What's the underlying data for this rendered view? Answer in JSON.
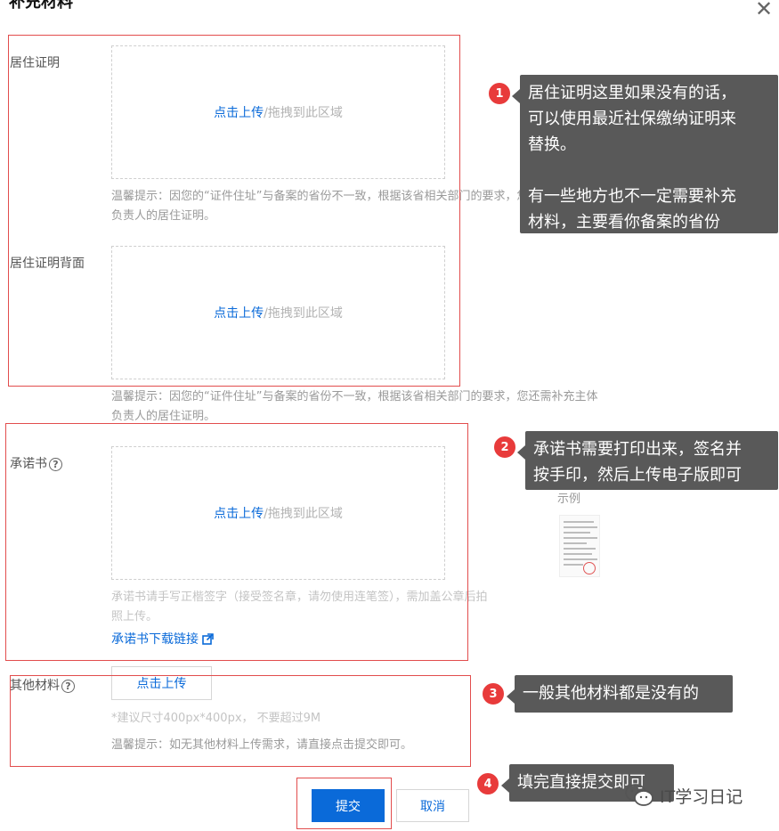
{
  "dialog": {
    "title": "补充材料",
    "close_glyph": "✕"
  },
  "fields": {
    "residence": {
      "label": "居住证明"
    },
    "residence_back": {
      "label": "居住证明背面"
    },
    "commitment": {
      "label": "承诺书"
    },
    "other": {
      "label": "其他材料"
    }
  },
  "dropzone": {
    "link_text": "点击上传",
    "rest_text": "/拖拽到此区域"
  },
  "hints": {
    "residence": [
      "温馨提示：因您的“证件住址”与备案的省份不一致，根据该省相关部门的要求，您还需补充主体",
      "负责人的居住证明。"
    ],
    "residence_back": [
      "温馨提示：因您的“证件住址”与备案的省份不一致，根据该省相关部门的要求，您还需补充主体",
      "负责人的居住证明。"
    ],
    "commitment": [
      "承诺书请手写正楷签字（接受签名章，请勿使用连笔签），需加盖公章后拍",
      "照上传。"
    ],
    "other_size": "*建议尺寸400px*400px， 不要超过9M",
    "other": "温馨提示：如无其他材料上传需求，请直接点击提交即可。"
  },
  "commitment_download_link": "承诺书下载链接",
  "sample_label": "示例",
  "buttons": {
    "upload": "点击上传",
    "submit": "提交",
    "cancel": "取消"
  },
  "callouts": [
    {
      "num": "1",
      "lines": [
        "居住证明这里如果没有的话，",
        "可以使用最近社保缴纳证明来",
        "替换。",
        "",
        "有一些地方也不一定需要补充",
        "材料，主要看你备案的省份"
      ]
    },
    {
      "num": "2",
      "lines": [
        "承诺书需要打印出来，签名并",
        "按手印，然后上传电子版即可"
      ]
    },
    {
      "num": "3",
      "lines": [
        "一般其他材料都是没有的"
      ]
    },
    {
      "num": "4",
      "lines": [
        "填完直接提交即可"
      ]
    }
  ],
  "watermark": {
    "text": "IT学习日记"
  },
  "colors": {
    "link_blue": "#0a6ad9",
    "annotation_red": "#e24d4d",
    "callout_gray": "#595959",
    "badge_red": "#e83b3b"
  }
}
